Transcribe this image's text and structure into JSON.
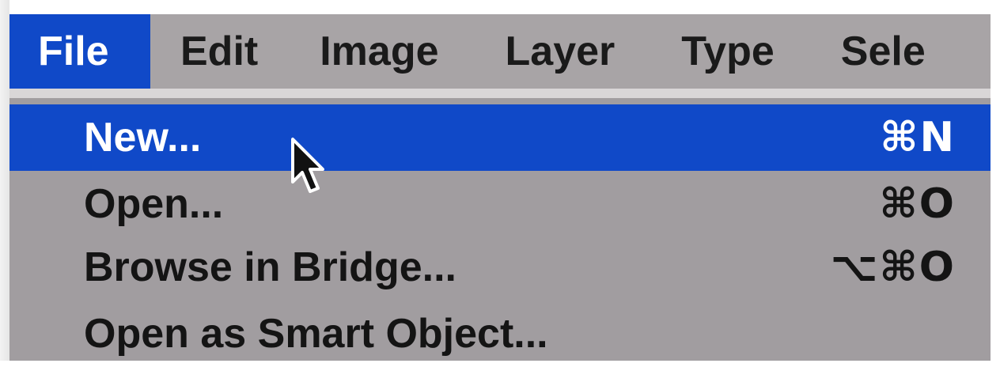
{
  "menubar": {
    "items": [
      {
        "label": "File",
        "active": true
      },
      {
        "label": "Edit"
      },
      {
        "label": "Image"
      },
      {
        "label": "Layer"
      },
      {
        "label": "Type"
      },
      {
        "label": "Sele"
      }
    ]
  },
  "file_menu": {
    "items": [
      {
        "label": "New...",
        "shortcut": "⌘N",
        "highlighted": true
      },
      {
        "label": "Open...",
        "shortcut": "⌘O"
      },
      {
        "label": "Browse in Bridge...",
        "shortcut": "⌥⌘O"
      },
      {
        "label": "Open as Smart Object...",
        "shortcut": ""
      }
    ]
  },
  "icons": {
    "cursor": "arrow-cursor-icon"
  },
  "colors": {
    "highlight": "#1049c8",
    "menubar_bg": "#a8a4a6",
    "dropdown_bg": "#a19da0"
  }
}
